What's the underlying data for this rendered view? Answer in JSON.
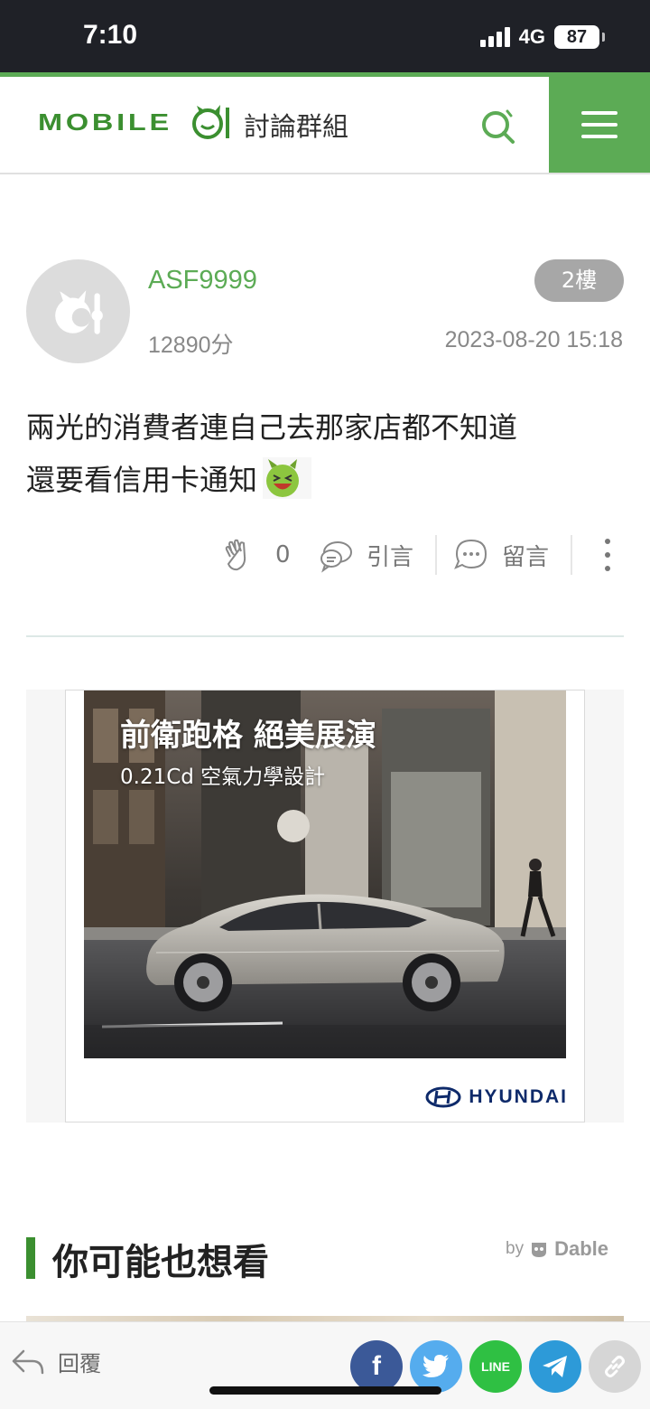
{
  "status_bar": {
    "time": "7:10",
    "network": "4G",
    "battery": "87"
  },
  "header": {
    "logo_text": "MOBILE",
    "section_title": "討論群組"
  },
  "post": {
    "username": "ASF9999",
    "score": "12890分",
    "floor": "2樓",
    "datetime": "2023-08-20 15:18",
    "content_line1": "兩光的消費者連自己去那家店都不知道",
    "content_line2": "還要看信用卡通知",
    "likes": "0",
    "quote_label": "引言",
    "comment_label": "留言"
  },
  "ad": {
    "headline": "前衛跑格 絕美展演",
    "subline": "0.21Cd 空氣力學設計",
    "brand": "HYUNDAI"
  },
  "recommend": {
    "title": "你可能也想看",
    "by": "by",
    "provider": "Dable"
  },
  "bottom_bar": {
    "reply_label": "回覆",
    "facebook": "f",
    "line": "LINE"
  },
  "colors": {
    "brand_green": "#5cab55",
    "dark_green": "#3b8f30",
    "status_bg": "#1f2127"
  }
}
